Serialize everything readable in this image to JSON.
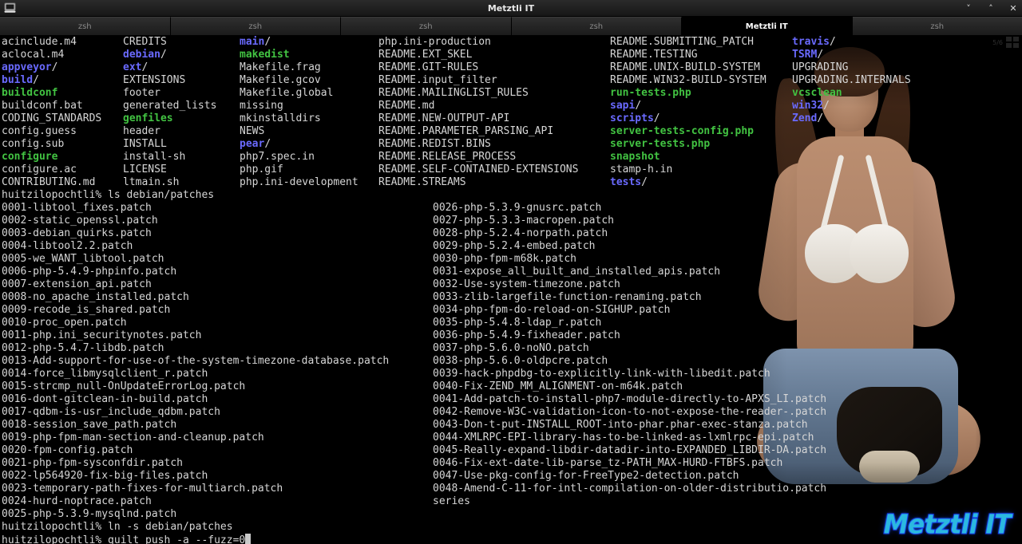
{
  "window": {
    "title": "Metztli IT",
    "icon": "terminal-icon",
    "controls": [
      {
        "name": "minimize-button",
        "glyph": "˅"
      },
      {
        "name": "maximize-button",
        "glyph": "˄"
      },
      {
        "name": "close-button",
        "glyph": "✕"
      }
    ]
  },
  "tabs": [
    {
      "label": "zsh",
      "active": false
    },
    {
      "label": "zsh",
      "active": false
    },
    {
      "label": "zsh",
      "active": false
    },
    {
      "label": "zsh",
      "active": false
    },
    {
      "label": "Metztli IT",
      "active": true
    },
    {
      "label": "zsh",
      "active": false
    }
  ],
  "page_indicator": {
    "text": "5/6",
    "icon": "workspace-grid-icon"
  },
  "logo": {
    "text": "Metztli IT",
    "fill": "#2bb8e0",
    "stroke": "#1126e8"
  },
  "colors": {
    "background": "#000000",
    "foreground": "#d6d6d6",
    "directory": "#6a6aff",
    "executable": "#42c342",
    "titlebar": "#232323",
    "tab_inactive_text": "#8a8a8a",
    "tab_active_bg": "#000000"
  },
  "terminal": {
    "host_prompt": "huitzilopochtli% ",
    "ls_columns": {
      "col_x": [
        0,
        152,
        298,
        472,
        762,
        990
      ],
      "rows": [
        [
          {
            "text": "acinclude.m4",
            "kind": "file"
          },
          {
            "text": "CREDITS",
            "kind": "file"
          },
          {
            "text": "main/",
            "kind": "dir"
          },
          {
            "text": "php.ini-production",
            "kind": "file"
          },
          {
            "text": "README.SUBMITTING_PATCH",
            "kind": "file"
          },
          {
            "text": "travis/",
            "kind": "dir"
          }
        ],
        [
          {
            "text": "aclocal.m4",
            "kind": "file"
          },
          {
            "text": "debian/",
            "kind": "dir"
          },
          {
            "text": "makedist",
            "kind": "exec"
          },
          {
            "text": "README.EXT_SKEL",
            "kind": "file"
          },
          {
            "text": "README.TESTING",
            "kind": "file"
          },
          {
            "text": "TSRM/",
            "kind": "dir"
          }
        ],
        [
          {
            "text": "appveyor/",
            "kind": "dir"
          },
          {
            "text": "ext/",
            "kind": "dir"
          },
          {
            "text": "Makefile.frag",
            "kind": "file"
          },
          {
            "text": "README.GIT-RULES",
            "kind": "file"
          },
          {
            "text": "README.UNIX-BUILD-SYSTEM",
            "kind": "file"
          },
          {
            "text": "UPGRADING",
            "kind": "file"
          }
        ],
        [
          {
            "text": "build/",
            "kind": "dir"
          },
          {
            "text": "EXTENSIONS",
            "kind": "file"
          },
          {
            "text": "Makefile.gcov",
            "kind": "file"
          },
          {
            "text": "README.input_filter",
            "kind": "file"
          },
          {
            "text": "README.WIN32-BUILD-SYSTEM",
            "kind": "file"
          },
          {
            "text": "UPGRADING.INTERNALS",
            "kind": "file"
          }
        ],
        [
          {
            "text": "buildconf",
            "kind": "exec"
          },
          {
            "text": "footer",
            "kind": "file"
          },
          {
            "text": "Makefile.global",
            "kind": "file"
          },
          {
            "text": "README.MAILINGLIST_RULES",
            "kind": "file"
          },
          {
            "text": "run-tests.php",
            "kind": "exec"
          },
          {
            "text": "vcsclean",
            "kind": "exec"
          }
        ],
        [
          {
            "text": "buildconf.bat",
            "kind": "file"
          },
          {
            "text": "generated_lists",
            "kind": "file"
          },
          {
            "text": "missing",
            "kind": "file"
          },
          {
            "text": "README.md",
            "kind": "file"
          },
          {
            "text": "sapi/",
            "kind": "dir"
          },
          {
            "text": "win32/",
            "kind": "dir"
          }
        ],
        [
          {
            "text": "CODING_STANDARDS",
            "kind": "file"
          },
          {
            "text": "genfiles",
            "kind": "exec"
          },
          {
            "text": "mkinstalldirs",
            "kind": "file"
          },
          {
            "text": "README.NEW-OUTPUT-API",
            "kind": "file"
          },
          {
            "text": "scripts/",
            "kind": "dir"
          },
          {
            "text": "Zend/",
            "kind": "dir"
          }
        ],
        [
          {
            "text": "config.guess",
            "kind": "file"
          },
          {
            "text": "header",
            "kind": "file"
          },
          {
            "text": "NEWS",
            "kind": "file"
          },
          {
            "text": "README.PARAMETER_PARSING_API",
            "kind": "file"
          },
          {
            "text": "server-tests-config.php",
            "kind": "exec"
          },
          {
            "text": "",
            "kind": "file"
          }
        ],
        [
          {
            "text": "config.sub",
            "kind": "file"
          },
          {
            "text": "INSTALL",
            "kind": "file"
          },
          {
            "text": "pear/",
            "kind": "dir"
          },
          {
            "text": "README.REDIST.BINS",
            "kind": "file"
          },
          {
            "text": "server-tests.php",
            "kind": "exec"
          },
          {
            "text": "",
            "kind": "file"
          }
        ],
        [
          {
            "text": "configure",
            "kind": "exec"
          },
          {
            "text": "install-sh",
            "kind": "file"
          },
          {
            "text": "php7.spec.in",
            "kind": "file"
          },
          {
            "text": "README.RELEASE_PROCESS",
            "kind": "file"
          },
          {
            "text": "snapshot",
            "kind": "exec"
          },
          {
            "text": "",
            "kind": "file"
          }
        ],
        [
          {
            "text": "configure.ac",
            "kind": "file"
          },
          {
            "text": "LICENSE",
            "kind": "file"
          },
          {
            "text": "php.gif",
            "kind": "file"
          },
          {
            "text": "README.SELF-CONTAINED-EXTENSIONS",
            "kind": "file"
          },
          {
            "text": "stamp-h.in",
            "kind": "file"
          },
          {
            "text": "",
            "kind": "file"
          }
        ],
        [
          {
            "text": "CONTRIBUTING.md",
            "kind": "file"
          },
          {
            "text": "ltmain.sh",
            "kind": "file"
          },
          {
            "text": "php.ini-development",
            "kind": "file"
          },
          {
            "text": "README.STREAMS",
            "kind": "file"
          },
          {
            "text": "tests/",
            "kind": "dir"
          },
          {
            "text": "",
            "kind": "file"
          }
        ]
      ]
    },
    "command_ls_patches": "ls debian/patches",
    "patches_left": [
      "0001-libtool_fixes.patch",
      "0002-static_openssl.patch",
      "0003-debian_quirks.patch",
      "0004-libtool2.2.patch",
      "0005-we_WANT_libtool.patch",
      "0006-php-5.4.9-phpinfo.patch",
      "0007-extension_api.patch",
      "0008-no_apache_installed.patch",
      "0009-recode_is_shared.patch",
      "0010-proc_open.patch",
      "0011-php.ini_securitynotes.patch",
      "0012-php-5.4.7-libdb.patch",
      "0013-Add-support-for-use-of-the-system-timezone-database.patch",
      "0014-force_libmysqlclient_r.patch",
      "0015-strcmp_null-OnUpdateErrorLog.patch",
      "0016-dont-gitclean-in-build.patch",
      "0017-qdbm-is-usr_include_qdbm.patch",
      "0018-session_save_path.patch",
      "0019-php-fpm-man-section-and-cleanup.patch",
      "0020-fpm-config.patch",
      "0021-php-fpm-sysconfdir.patch",
      "0022-lp564920-fix-big-files.patch",
      "0023-temporary-path-fixes-for-multiarch.patch",
      "0024-hurd-noptrace.patch",
      "0025-php-5.3.9-mysqlnd.patch"
    ],
    "patches_right": [
      "0026-php-5.3.9-gnusrc.patch",
      "0027-php-5.3.3-macropen.patch",
      "0028-php-5.2.4-norpath.patch",
      "0029-php-5.2.4-embed.patch",
      "0030-php-fpm-m68k.patch",
      "0031-expose_all_built_and_installed_apis.patch",
      "0032-Use-system-timezone.patch",
      "0033-zlib-largefile-function-renaming.patch",
      "0034-php-fpm-do-reload-on-SIGHUP.patch",
      "0035-php-5.4.8-ldap_r.patch",
      "0036-php-5.4.9-fixheader.patch",
      "0037-php-5.6.0-noNO.patch",
      "0038-php-5.6.0-oldpcre.patch",
      "0039-hack-phpdbg-to-explicitly-link-with-libedit.patch",
      "0040-Fix-ZEND_MM_ALIGNMENT-on-m64k.patch",
      "0041-Add-patch-to-install-php7-module-directly-to-APXS_LI.patch",
      "0042-Remove-W3C-validation-icon-to-not-expose-the-reader-.patch",
      "0043-Don-t-put-INSTALL_ROOT-into-phar.phar-exec-stanza.patch",
      "0044-XMLRPC-EPI-library-has-to-be-linked-as-lxmlrpc-epi.patch",
      "0045-Really-expand-libdir-datadir-into-EXPANDED_LIBDIR-DA.patch",
      "0046-Fix-ext-date-lib-parse_tz-PATH_MAX-HURD-FTBFS.patch",
      "0047-Use-pkg-config-for-FreeType2-detection.patch",
      "0048-Amend-C-11-for-intl-compilation-on-older-distributio.patch",
      "series"
    ],
    "command_ln": "ln -s debian/patches",
    "command_quilt": "quilt push -a --fuzz=0"
  }
}
